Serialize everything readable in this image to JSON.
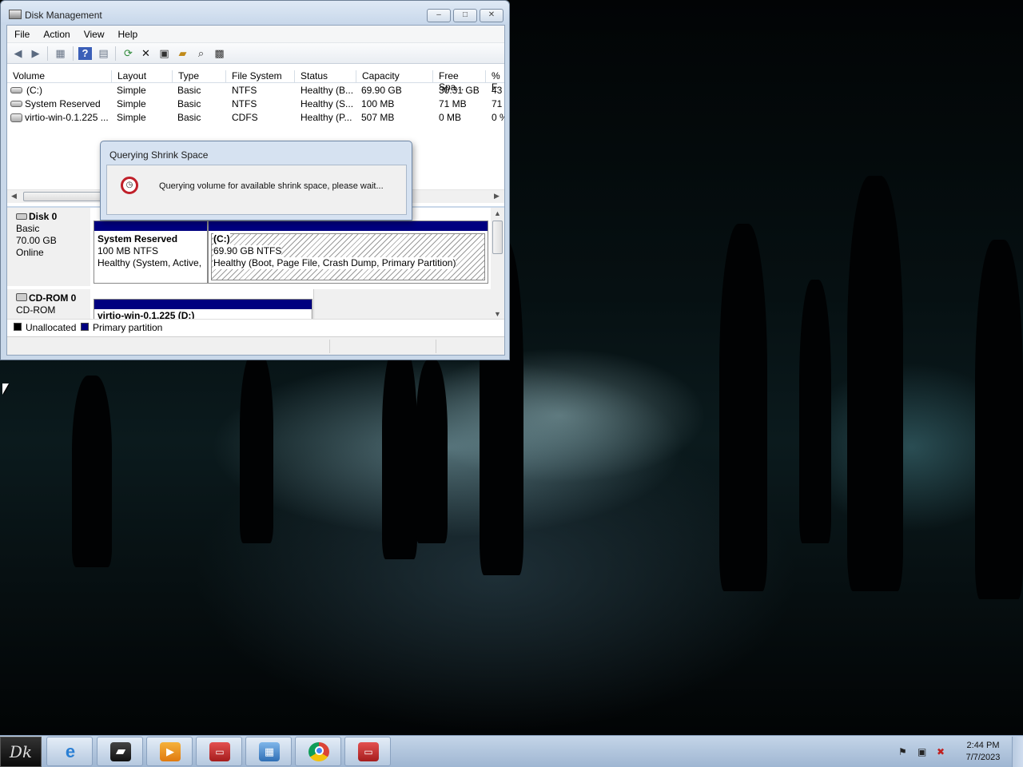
{
  "window": {
    "title": "Disk Management",
    "minimize": "–",
    "maximize": "□",
    "close": "✕"
  },
  "menu": [
    "File",
    "Action",
    "View",
    "Help"
  ],
  "toolbar_icons": [
    "back-icon",
    "forward-icon",
    "console-tree-icon",
    "help-icon",
    "show-hide-icon",
    "refresh-icon",
    "delete-icon",
    "properties-icon",
    "open-icon",
    "search-icon",
    "settings-icon"
  ],
  "volume_list": {
    "columns": [
      "Volume",
      "Layout",
      "Type",
      "File System",
      "Status",
      "Capacity",
      "Free Spa...",
      "% F"
    ],
    "rows": [
      [
        "(C:)",
        "Simple",
        "Basic",
        "NTFS",
        "Healthy (B...",
        "69.90 GB",
        "30.31 GB",
        "43"
      ],
      [
        "System Reserved",
        "Simple",
        "Basic",
        "NTFS",
        "Healthy (S...",
        "100 MB",
        "71 MB",
        "71"
      ],
      [
        "virtio-win-0.1.225 ...",
        "Simple",
        "Basic",
        "CDFS",
        "Healthy (P...",
        "507 MB",
        "0 MB",
        "0 %"
      ]
    ]
  },
  "dialog": {
    "title": "Querying Shrink Space",
    "message": "Querying volume for available shrink space, please wait..."
  },
  "disks": [
    {
      "name": "Disk 0",
      "type": "Basic",
      "size": "70.00 GB",
      "state": "Online",
      "partitions": [
        {
          "name": "System Reserved",
          "size": "100 MB NTFS",
          "status": "Healthy (System, Active,"
        },
        {
          "name": "(C:)",
          "size": "69.90 GB NTFS",
          "status": "Healthy (Boot, Page File, Crash Dump, Primary Partition)"
        }
      ]
    },
    {
      "name": "CD-ROM 0",
      "type": "CD-ROM",
      "partitions": [
        {
          "name": "virtio-win-0.1.225  (D:)"
        }
      ]
    }
  ],
  "legend": [
    "Unallocated",
    "Primary partition"
  ],
  "colors": {
    "unallocated": "#000000",
    "primary_partition": "#000080"
  },
  "taskbar": {
    "start_label": "Dk",
    "items": [
      "internet-explorer-icon",
      "file-explorer-icon",
      "media-player-icon",
      "toolbox-icon",
      "control-panel-icon",
      "chrome-icon",
      "toolbox-icon"
    ],
    "tray_icons": [
      "flag-icon",
      "network-icon",
      "volume-muted-icon"
    ],
    "time": "2:44 PM",
    "date": "7/7/2023"
  }
}
